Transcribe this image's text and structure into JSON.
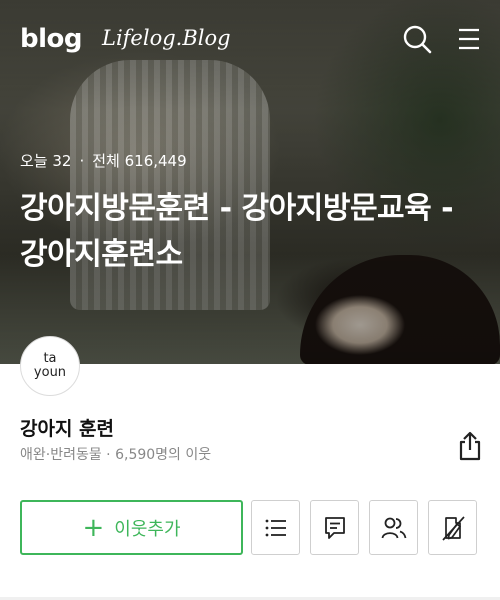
{
  "header": {
    "logo": "blog",
    "blog_name": "Lifelog.Blog",
    "search_icon": "search-icon",
    "menu_icon": "hamburger-menu-icon"
  },
  "hero": {
    "today_label": "오늘 32",
    "total_label": "전체 616,449",
    "separator": "·",
    "title": "강아지방문훈련 - 강아지방문교육 - 강아지훈련소"
  },
  "profile": {
    "avatar_text_line1": "ta",
    "avatar_text_line2": "youn",
    "name": "강아지 훈련",
    "meta": "애완·반려동물 · 6,590명의 이웃",
    "share_icon": "share-icon"
  },
  "actions": {
    "add_neighbor_label": "이웃추가",
    "add_neighbor_icon": "plus-icon",
    "list_icon": "list-icon",
    "guestbook_icon": "chat-icon",
    "neighbors_icon": "neighbors-icon",
    "write_icon": "pen-icon",
    "accent_color": "#3eb65a"
  }
}
